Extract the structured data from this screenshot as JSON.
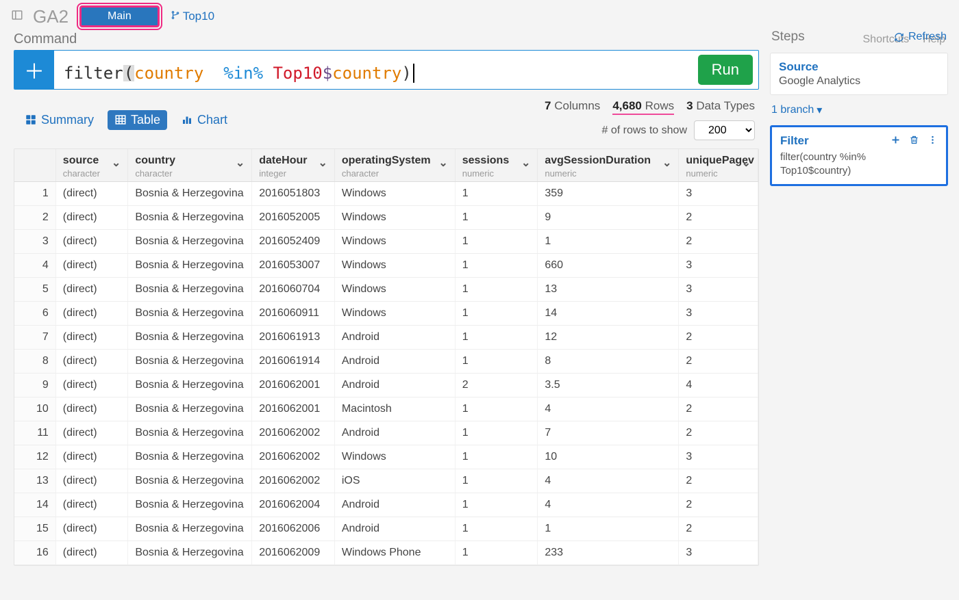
{
  "project": "GA2",
  "tabs": {
    "main": "Main",
    "top10": "Top10"
  },
  "command_label": "Command",
  "links": {
    "shortcuts": "Shortcuts",
    "help": "Help"
  },
  "command": {
    "fn": "filter",
    "paren_open": "(",
    "arg1": "country",
    "sp1": "  ",
    "op": "%in%",
    "sp2": " ",
    "obj": "Top10",
    "dollar": "$",
    "arg2": "country",
    "paren_close": ")"
  },
  "run_label": "Run",
  "views": {
    "summary": "Summary",
    "table": "Table",
    "chart": "Chart"
  },
  "meta": {
    "columns_n": "7",
    "columns_lbl": "Columns",
    "rows_n": "4,680",
    "rows_lbl": "Rows",
    "types_n": "3",
    "types_lbl": "Data Types",
    "rows_show_label": "# of rows to show",
    "rows_show_value": "200"
  },
  "columns": [
    {
      "name": "source",
      "type": "character"
    },
    {
      "name": "country",
      "type": "character"
    },
    {
      "name": "dateHour",
      "type": "integer"
    },
    {
      "name": "operatingSystem",
      "type": "character"
    },
    {
      "name": "sessions",
      "type": "numeric"
    },
    {
      "name": "avgSessionDuration",
      "type": "numeric"
    },
    {
      "name": "uniquePagev",
      "type": "numeric"
    }
  ],
  "rows": [
    [
      "1",
      "(direct)",
      "Bosnia & Herzegovina",
      "2016051803",
      "Windows",
      "1",
      "359",
      "3"
    ],
    [
      "2",
      "(direct)",
      "Bosnia & Herzegovina",
      "2016052005",
      "Windows",
      "1",
      "9",
      "2"
    ],
    [
      "3",
      "(direct)",
      "Bosnia & Herzegovina",
      "2016052409",
      "Windows",
      "1",
      "1",
      "2"
    ],
    [
      "4",
      "(direct)",
      "Bosnia & Herzegovina",
      "2016053007",
      "Windows",
      "1",
      "660",
      "3"
    ],
    [
      "5",
      "(direct)",
      "Bosnia & Herzegovina",
      "2016060704",
      "Windows",
      "1",
      "13",
      "3"
    ],
    [
      "6",
      "(direct)",
      "Bosnia & Herzegovina",
      "2016060911",
      "Windows",
      "1",
      "14",
      "3"
    ],
    [
      "7",
      "(direct)",
      "Bosnia & Herzegovina",
      "2016061913",
      "Android",
      "1",
      "12",
      "2"
    ],
    [
      "8",
      "(direct)",
      "Bosnia & Herzegovina",
      "2016061914",
      "Android",
      "1",
      "8",
      "2"
    ],
    [
      "9",
      "(direct)",
      "Bosnia & Herzegovina",
      "2016062001",
      "Android",
      "2",
      "3.5",
      "4"
    ],
    [
      "10",
      "(direct)",
      "Bosnia & Herzegovina",
      "2016062001",
      "Macintosh",
      "1",
      "4",
      "2"
    ],
    [
      "11",
      "(direct)",
      "Bosnia & Herzegovina",
      "2016062002",
      "Android",
      "1",
      "7",
      "2"
    ],
    [
      "12",
      "(direct)",
      "Bosnia & Herzegovina",
      "2016062002",
      "Windows",
      "1",
      "10",
      "3"
    ],
    [
      "13",
      "(direct)",
      "Bosnia & Herzegovina",
      "2016062002",
      "iOS",
      "1",
      "4",
      "2"
    ],
    [
      "14",
      "(direct)",
      "Bosnia & Herzegovina",
      "2016062004",
      "Android",
      "1",
      "4",
      "2"
    ],
    [
      "15",
      "(direct)",
      "Bosnia & Herzegovina",
      "2016062006",
      "Android",
      "1",
      "1",
      "2"
    ],
    [
      "16",
      "(direct)",
      "Bosnia & Herzegovina",
      "2016062009",
      "Windows Phone",
      "1",
      "233",
      "3"
    ]
  ],
  "steps": {
    "title": "Steps",
    "refresh": "Refresh",
    "source_title": "Source",
    "source_name": "Google Analytics",
    "branch_label": "1 branch",
    "filter_title": "Filter",
    "filter_body": "filter(country %in% Top10$country)"
  }
}
